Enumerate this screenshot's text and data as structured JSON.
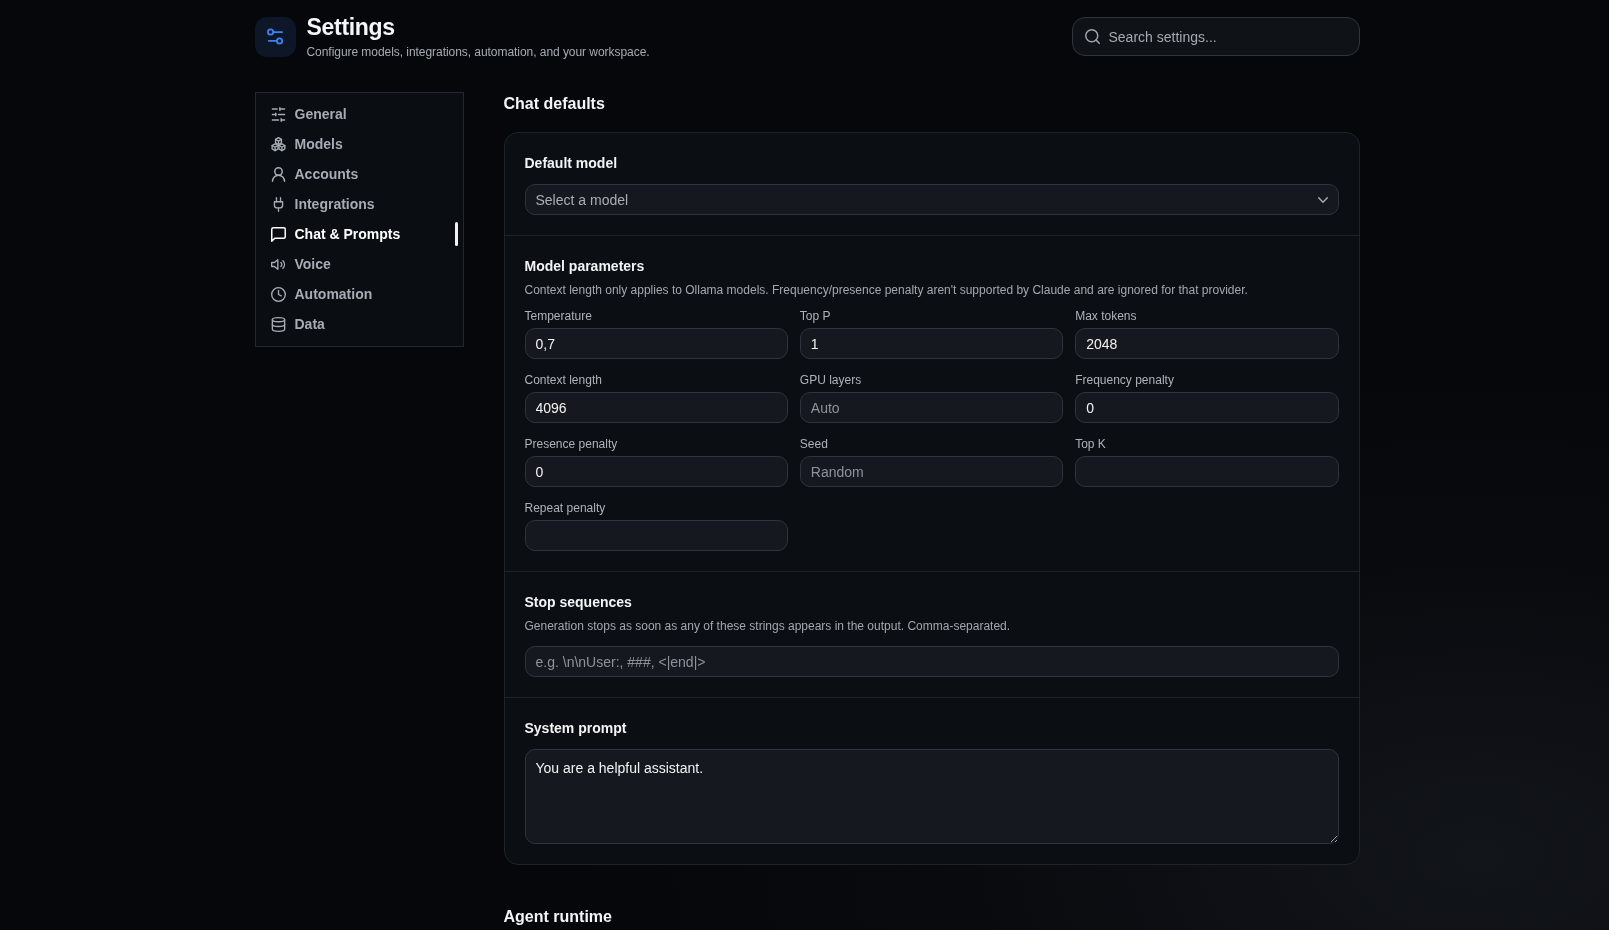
{
  "header": {
    "title": "Settings",
    "subtitle": "Configure models, integrations, automation, and your workspace."
  },
  "search": {
    "placeholder": "Search settings..."
  },
  "sidebar": {
    "items": [
      {
        "label": "General",
        "selected": false
      },
      {
        "label": "Models",
        "selected": false
      },
      {
        "label": "Accounts",
        "selected": false
      },
      {
        "label": "Integrations",
        "selected": false
      },
      {
        "label": "Chat & Prompts",
        "selected": true
      },
      {
        "label": "Voice",
        "selected": false
      },
      {
        "label": "Automation",
        "selected": false
      },
      {
        "label": "Data",
        "selected": false
      }
    ]
  },
  "sections": [
    {
      "title": "Chat defaults",
      "groups": [
        {
          "kind": "select",
          "title": "Default model",
          "placeholder": "Select a model"
        },
        {
          "kind": "fields",
          "title": "Model parameters",
          "description": "Context length only applies to Ollama models. Frequency/presence penalty aren't supported by Claude and are ignored for that provider.",
          "fields": [
            {
              "label": "Temperature",
              "value": "0,7"
            },
            {
              "label": "Top P",
              "value": "1"
            },
            {
              "label": "Max tokens",
              "value": "2048"
            },
            {
              "label": "Context length",
              "value": "4096"
            },
            {
              "label": "GPU layers",
              "placeholder": "Auto"
            },
            {
              "label": "Frequency penalty",
              "value": "0"
            },
            {
              "label": "Presence penalty",
              "value": "0"
            },
            {
              "label": "Seed",
              "placeholder": "Random"
            },
            {
              "label": "Top K"
            },
            {
              "label": "Repeat penalty"
            }
          ]
        },
        {
          "kind": "text",
          "title": "Stop sequences",
          "description": "Generation stops as soon as any of these strings appears in the output. Comma-separated.",
          "placeholder": "e.g. \\n\\nUser:, ###, <|end|>"
        },
        {
          "kind": "textarea",
          "title": "System prompt",
          "value": "You are a helpful assistant."
        }
      ]
    },
    {
      "title": "Agent runtime"
    }
  ]
}
